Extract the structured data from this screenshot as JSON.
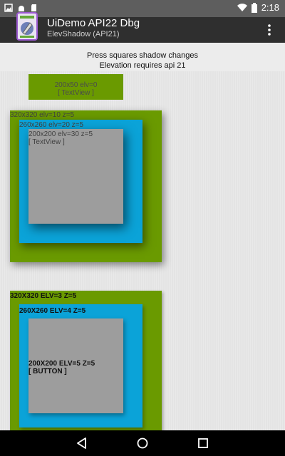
{
  "status_bar": {
    "time": "2:18",
    "icons": [
      "photo-icon",
      "android-debug-icon",
      "sd-card-icon",
      "wifi-icon",
      "battery-icon"
    ]
  },
  "app_bar": {
    "title": "UiDemo API22 Dbg",
    "subtitle": "ElevShadow (API21)",
    "overflow": "overflow-menu-icon"
  },
  "header": {
    "line1": "Press squares shadow changes",
    "line2": "Elevation requires api 21"
  },
  "views": {
    "small_text": "200x50 elv=0\n[ TextView ]",
    "outer_green_label": "320x320 elv=10 z=5",
    "mid_blue_label": "260x260 elv=20 z=5",
    "inner_gray_label": "200x200 elv=30 z=5\n[ TextView ]"
  },
  "buttons": {
    "outer_green_label": "320X320 ELV=3 Z=5",
    "mid_blue_label": "260X260 ELV=4 Z=5",
    "inner_gray_label": "200X200 ELV=5 Z=5\n[ BUTTON ]"
  },
  "colors": {
    "green": "#6a9a00",
    "blue": "#0ba3d8",
    "gray": "#9d9d9d"
  }
}
